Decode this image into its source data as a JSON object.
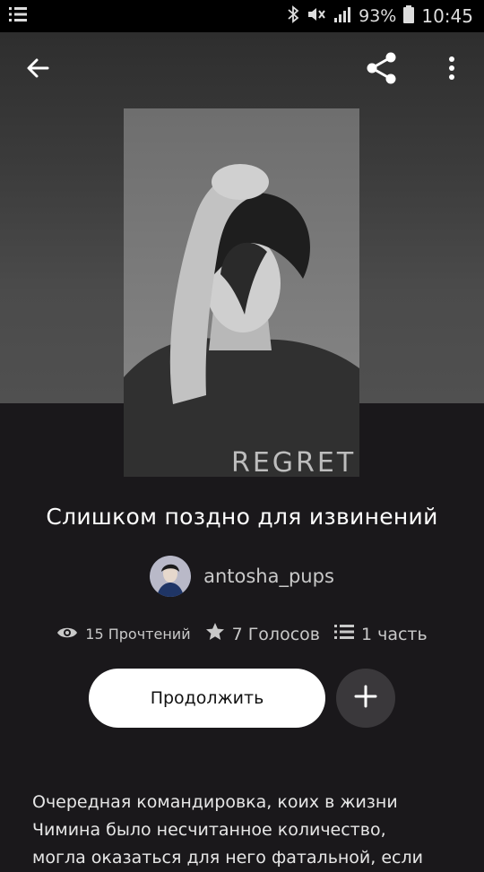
{
  "status_bar": {
    "battery_percent": "93%",
    "time": "10:45",
    "icons": [
      "menu-icon",
      "bluetooth-icon",
      "mute-icon",
      "signal-icon",
      "battery-icon"
    ]
  },
  "app_bar": {
    "icons": [
      "back-arrow-icon",
      "share-icon",
      "more-vertical-icon"
    ]
  },
  "book": {
    "cover_text": "REGRET",
    "title": "Слишком поздно для извинений",
    "author": "antosha_pups",
    "stats": {
      "reads": "15 Прочтений",
      "votes": "7 Голосов",
      "parts": "1 часть"
    },
    "continue_label": "Продолжить",
    "add_icon": "plus-icon",
    "description": "Очередная командировка, коих в жизни Чимина было несчитанное количество, могла оказаться для него фатальной, если"
  },
  "colors": {
    "background": "#1a181b",
    "hero": "#4a4a4a",
    "button_primary": "#ffffff",
    "button_secondary": "#3a383b",
    "muted_text": "#c9c9c9"
  }
}
